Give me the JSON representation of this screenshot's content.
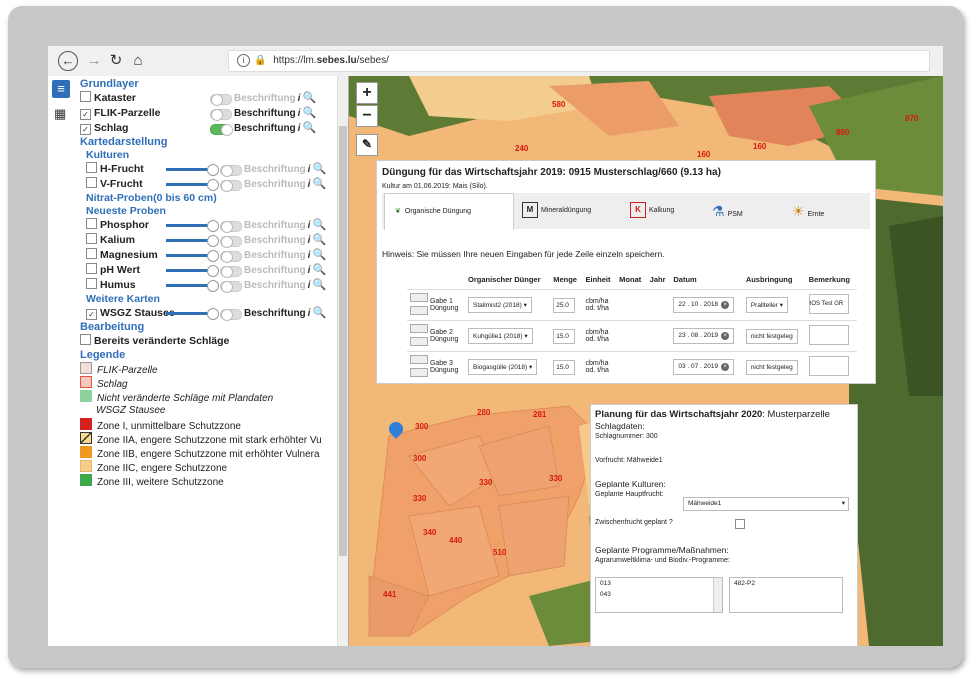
{
  "browser": {
    "url_prefix": "https://lm.",
    "url_domain": "sebes.lu",
    "url_suffix": "/sebes/"
  },
  "sidebar": {
    "grundlayer_title": "Grundlayer",
    "kataster": "Kataster",
    "flik": "FLIK-Parzelle",
    "schlag": "Schlag",
    "beschriftung": "Beschriftung",
    "kartedarstellung": "Kartedarstellung",
    "kulturen": "Kulturen",
    "hfrucht": "H-Frucht",
    "vfrucht": "V-Frucht",
    "nitrat": "Nitrat-Proben(0 bis 60 cm)",
    "neueste": "Neueste Proben",
    "phosphor": "Phosphor",
    "kalium": "Kalium",
    "magnesium": "Magnesium",
    "phwert": "pH Wert",
    "humus": "Humus",
    "weitere": "Weitere Karten",
    "wsgz": "WSGZ Stausee",
    "bearbeitung": "Bearbeitung",
    "bereits": "Bereits veränderte Schläge",
    "legende": "Legende",
    "legend": [
      {
        "label": "FLIK-Parzelle",
        "color": "#f2e0d8"
      },
      {
        "label": "Schlag",
        "color": "#f5c9bf"
      },
      {
        "label": "Nicht veränderte Schläge mit Plandaten",
        "color": "#8fd19e"
      },
      {
        "label": "WSGZ Stausee",
        "color": ""
      },
      {
        "label": "Zone I, unmittelbare Schutzzone",
        "color": "#d9201c"
      },
      {
        "label": "Zone IIA, engere Schutzzone mit stark erhöhter Vu",
        "color": "#f7d98a"
      },
      {
        "label": "Zone IIB, engere Schutzzone mit erhöhter Vulnera",
        "color": "#ef9a1e"
      },
      {
        "label": "Zone IIC, engere Schutzzone",
        "color": "#f6cf8d"
      },
      {
        "label": "Zone III, weitere Schutzzone",
        "color": "#3fa84a"
      }
    ]
  },
  "map": {
    "zoom_in": "+",
    "zoom_out": "−",
    "labels": [
      "580",
      "870",
      "880",
      "240",
      "160",
      "160",
      "280",
      "281",
      "300",
      "300",
      "330",
      "330",
      "330",
      "340",
      "440",
      "510",
      "441"
    ]
  },
  "dialog1": {
    "title": "Düngung für das Wirtschaftsjahr 2019: 0915 Musterschlag/660 (9.13 ha)",
    "subtitle": "Kultur am 01.06.2019: Mais (Silo).",
    "tabs": [
      "Organische Düngung",
      "Mineraldüngung",
      "Kalkung",
      "PSM",
      "Ernte"
    ],
    "hint": "Hinweis: Sie müssen Ihre neuen Eingaben für jede Zeile einzeln speichern.",
    "columns": [
      "Organischer Dünger",
      "Menge",
      "Einheit",
      "Monat",
      "Jahr",
      "Datum",
      "Ausbringung",
      "Bemerkung"
    ],
    "rows": [
      {
        "gabe": "Gabe 1",
        "typ": "Düngung",
        "duenger": "Stallmist2 (2018)",
        "menge": "25.0",
        "einheit1": "cbm/ha",
        "einheit2": "od. t/ha",
        "datum": "22 . 10 . 2018",
        "ausbringung": "Prallteller",
        "bemerkung": "IOS Test GR"
      },
      {
        "gabe": "Gabe 2",
        "typ": "Düngung",
        "duenger": "Kuhgülle1 (2018)",
        "menge": "15.0",
        "einheit1": "cbm/ha",
        "einheit2": "od. t/ha",
        "datum": "23 . 08 . 2019",
        "ausbringung": "nicht festgeleg",
        "bemerkung": ""
      },
      {
        "gabe": "Gabe 3",
        "typ": "Düngung",
        "duenger": "Biogasgülle (2018)",
        "menge": "15.0",
        "einheit1": "cbm/ha",
        "einheit2": "od. t/ha",
        "datum": "03 . 07 . 2019",
        "ausbringung": "nicht festgeleg",
        "bemerkung": ""
      }
    ]
  },
  "dialog2": {
    "title_bold": "Planung für das Wirtschaftsjahr 2020",
    "title_rest": ": Musterparzelle",
    "schlagdaten": "Schlagdaten:",
    "schlagnummer": "Schlagnummer: 300",
    "vorfrucht": "Vorfrucht: Mähweide1",
    "geplante_kulturen": "Geplante Kulturen:",
    "hauptfrucht_label": "Geplante Hauptfrucht:",
    "hauptfrucht_value": "Mähweide1",
    "zwischenfrucht": "Zwischenfrucht geplant ?",
    "programme": "Geplante Programme/Maßnahmen:",
    "agrar": "Agrarumweltklima- und Biodiv.-Programme:",
    "list_items": [
      "013",
      "043"
    ],
    "right_item": "482-P2"
  }
}
